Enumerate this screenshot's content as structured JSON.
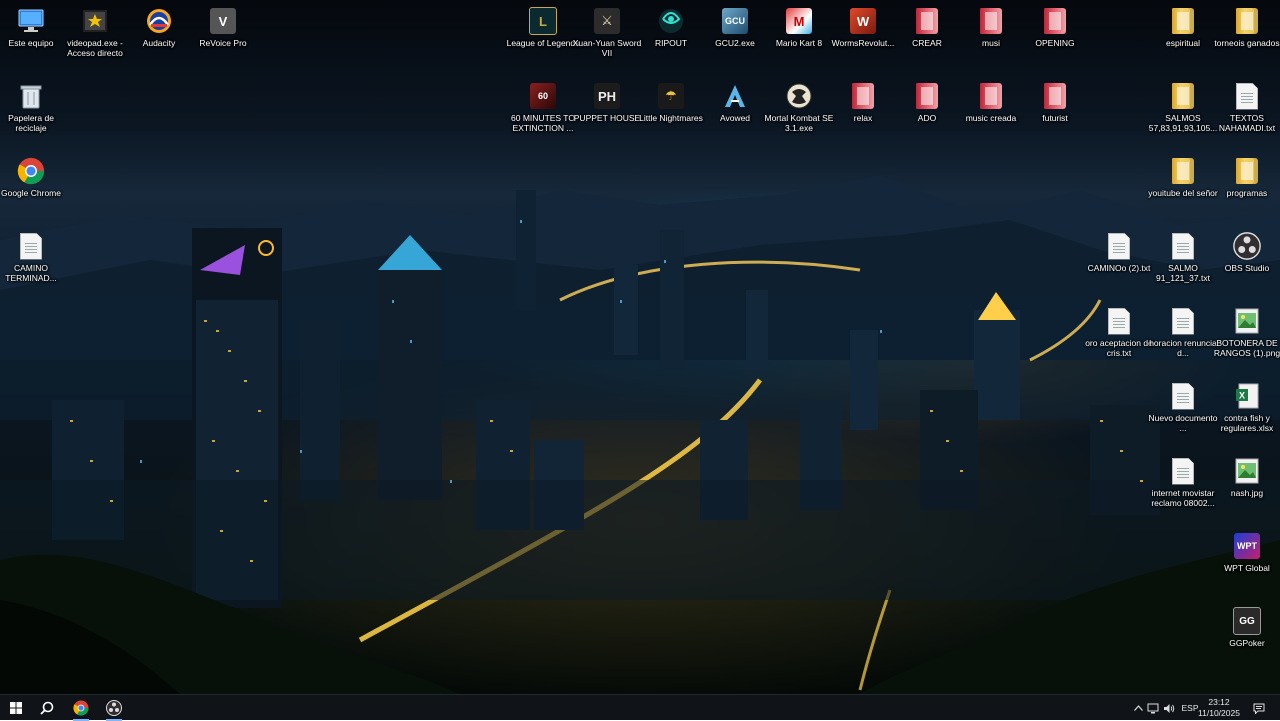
{
  "desktop_icons": [
    {
      "label": "Este equipo",
      "icon": "computer-icon"
    },
    {
      "label": "videopad.exe - Acceso directo",
      "icon": "videopad-icon"
    },
    {
      "label": "Audacity",
      "icon": "audacity-icon"
    },
    {
      "label": "ReVoice Pro",
      "icon": "revoice-icon"
    },
    {
      "label": "League of Legends",
      "icon": "league-icon"
    },
    {
      "label": "Xuan-Yuan Sword VII",
      "icon": "xuanyuan-icon"
    },
    {
      "label": "RIPOUT",
      "icon": "ripout-icon"
    },
    {
      "label": "GCU2.exe",
      "icon": "gcu2-icon"
    },
    {
      "label": "Mario Kart 8",
      "icon": "mario-kart-icon"
    },
    {
      "label": "WormsRevolut...",
      "icon": "worms-icon"
    },
    {
      "label": "CREAR",
      "icon": "folder-icon"
    },
    {
      "label": "musi",
      "icon": "folder-icon"
    },
    {
      "label": "OPENING",
      "icon": "folder-icon"
    },
    {
      "label": "espiritual",
      "icon": "folder-icon"
    },
    {
      "label": "torneois ganados",
      "icon": "folder-icon"
    },
    {
      "label": "Papelera de reciclaje",
      "icon": "recycle-bin-icon"
    },
    {
      "label": "60 MINUTES TO EXTINCTION ...",
      "icon": "sixty-minutes-icon"
    },
    {
      "label": "PUPPET HOUSE",
      "icon": "puppet-house-icon"
    },
    {
      "label": "Little Nightmares",
      "icon": "little-nightmares-icon"
    },
    {
      "label": "Avowed",
      "icon": "avowed-icon"
    },
    {
      "label": "Mortal Kombat SE 3.1.exe",
      "icon": "mortal-kombat-icon"
    },
    {
      "label": "relax",
      "icon": "folder-icon"
    },
    {
      "label": "ADO",
      "icon": "folder-icon"
    },
    {
      "label": "music creada",
      "icon": "folder-icon"
    },
    {
      "label": "futurist",
      "icon": "folder-icon"
    },
    {
      "label": "SALMOS 57,83,91,93,105...",
      "icon": "folder-icon"
    },
    {
      "label": "TEXTOS NAHAMADI.txt",
      "icon": "text-file-icon"
    },
    {
      "label": "Google Chrome",
      "icon": "chrome-icon"
    },
    {
      "label": "youitube del señor",
      "icon": "folder-icon"
    },
    {
      "label": "programas",
      "icon": "folder-icon"
    },
    {
      "label": "CAMINO TERMINAD...",
      "icon": "text-file-icon"
    },
    {
      "label": "CAMINOo (2).txt",
      "icon": "text-file-icon"
    },
    {
      "label": "SALMO 91_121_37.txt",
      "icon": "text-file-icon"
    },
    {
      "label": "OBS Studio",
      "icon": "obs-icon"
    },
    {
      "label": "oro aceptacion de cris.txt",
      "icon": "text-file-icon"
    },
    {
      "label": "horacion renuncia d...",
      "icon": "text-file-icon"
    },
    {
      "label": "BOTONERA DE RANGOS (1).png",
      "icon": "image-file-icon"
    },
    {
      "label": "Nuevo documento ...",
      "icon": "text-file-icon"
    },
    {
      "label": "contra fish y regulares.xlsx",
      "icon": "excel-file-icon"
    },
    {
      "label": "internet movistar reclamo 08002...",
      "icon": "text-file-icon"
    },
    {
      "label": "nash.jpg",
      "icon": "image-file-icon"
    },
    {
      "label": "WPT Global",
      "icon": "wpt-global-icon"
    },
    {
      "label": "GGPoker",
      "icon": "ggpoker-icon"
    }
  ],
  "taskbar": {
    "start": "start-icon",
    "search": "search-icon",
    "pinned": [
      "chrome-icon",
      "obs-icon"
    ],
    "tray": {
      "language": "ESP",
      "time": "23:12",
      "date": "11/10/2025"
    }
  }
}
